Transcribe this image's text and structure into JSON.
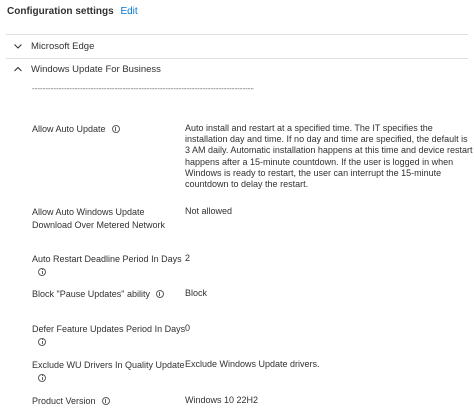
{
  "header": {
    "title": "Configuration settings",
    "edit_label": "Edit"
  },
  "sections": [
    {
      "label": "Microsoft Edge",
      "expanded": false
    },
    {
      "label": "Windows Update For Business",
      "expanded": true
    }
  ],
  "divider_text": "------------------------------------------------------------------------------------",
  "settings": [
    {
      "label": "Allow Auto Update",
      "value": "Auto install and restart at a specified time. The IT specifies the installation day and time. If no day and time are specified, the default is 3 AM daily. Automatic installation happens at this time and device restart happens after a 15-minute countdown. If the user is logged in when Windows is ready to restart, the user can interrupt the 15-minute countdown to delay the restart."
    },
    {
      "label": "Allow Auto Windows Update Download Over Metered Network",
      "value": "Not allowed"
    },
    {
      "label": "Auto Restart Deadline Period In Days",
      "value": "2"
    },
    {
      "label": "Block \"Pause Updates\" ability",
      "value": "Block"
    },
    {
      "label": "Defer Feature Updates Period In Days",
      "value": "0"
    },
    {
      "label": "Exclude WU Drivers In Quality Update",
      "value": "Exclude Windows Update drivers."
    },
    {
      "label": "Product Version",
      "value": "Windows 10 22H2"
    }
  ]
}
